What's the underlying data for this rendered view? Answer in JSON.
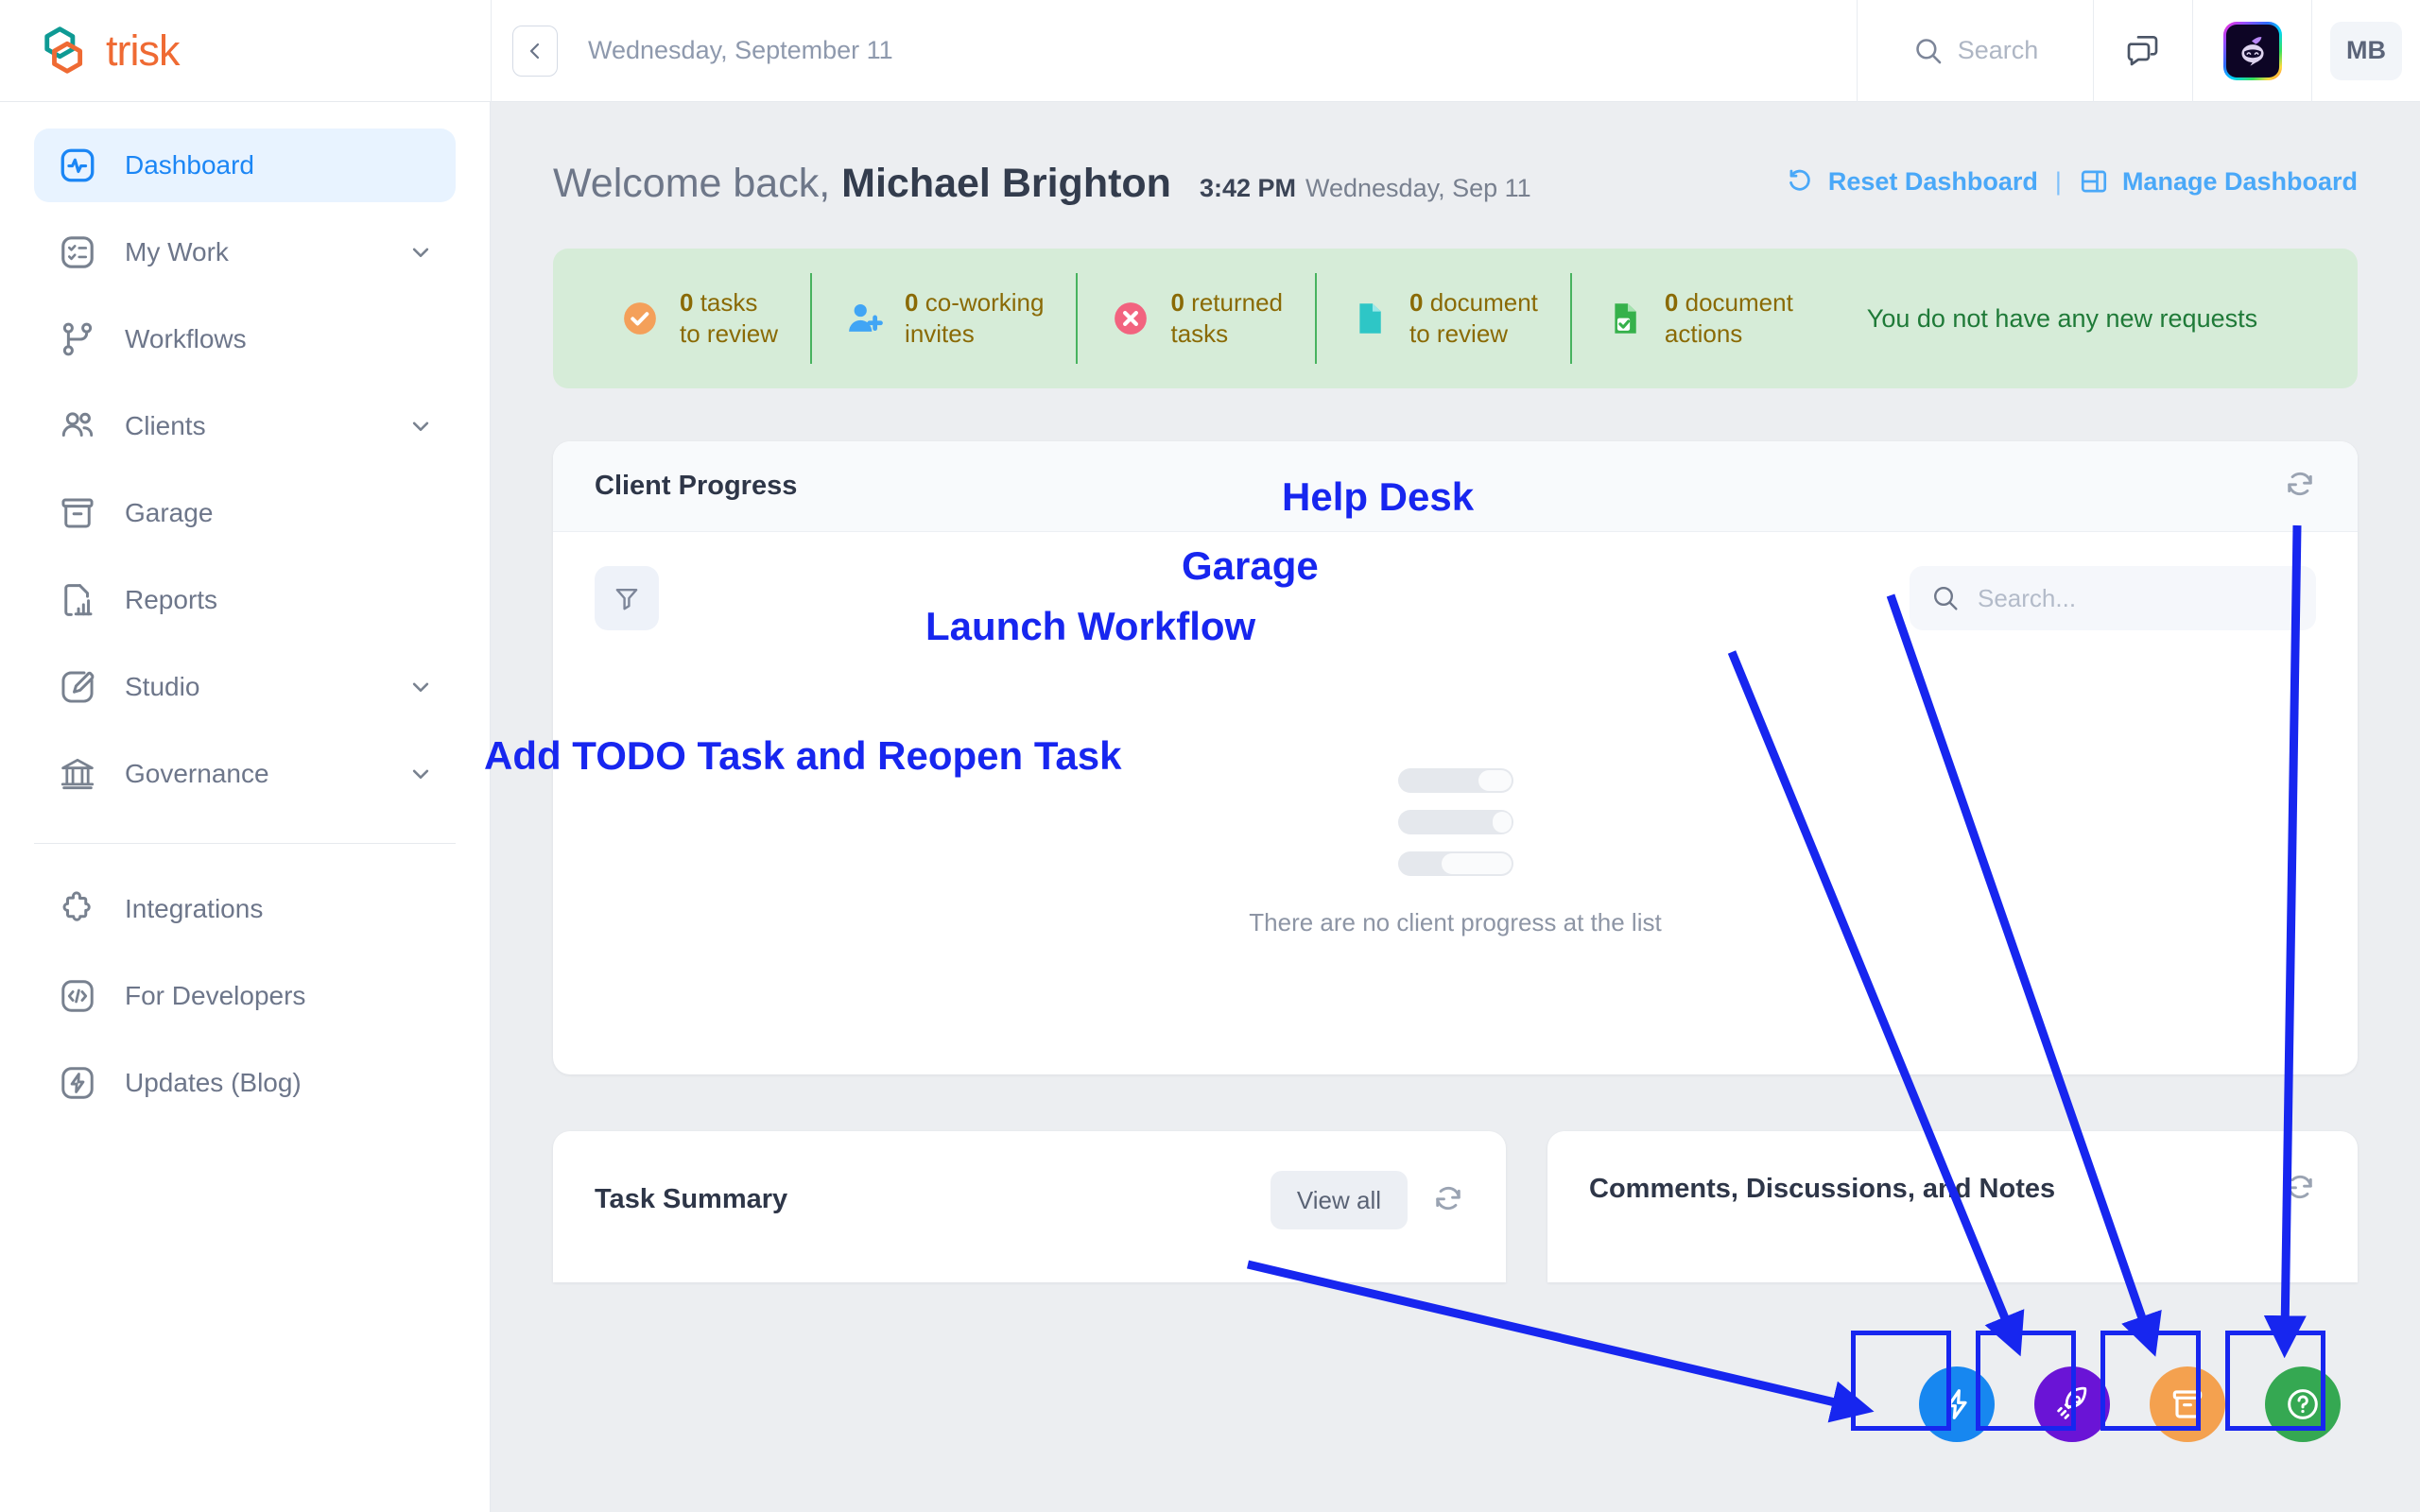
{
  "brand": {
    "name": "trisk",
    "logo_icon": "trisk-hexagon-logo",
    "teal": "#0e9a94",
    "orange": "#ef6a33"
  },
  "topbar": {
    "collapse_icon": "chevron-left-icon",
    "date": "Wednesday, September 11",
    "search_label": "Search",
    "search_icon": "search-icon",
    "chat_icon": "comments-icon",
    "ai_icon": "ai-assistant-icon",
    "avatar_initials": "MB"
  },
  "sidebar": {
    "items": [
      {
        "label": "Dashboard",
        "icon": "dashboard-activity-icon",
        "active": true,
        "expandable": false
      },
      {
        "label": "My Work",
        "icon": "checklist-icon",
        "active": false,
        "expandable": true
      },
      {
        "label": "Workflows",
        "icon": "workflow-branch-icon",
        "active": false,
        "expandable": false
      },
      {
        "label": "Clients",
        "icon": "users-icon",
        "active": false,
        "expandable": true
      },
      {
        "label": "Garage",
        "icon": "archive-box-icon",
        "active": false,
        "expandable": false
      },
      {
        "label": "Reports",
        "icon": "report-chart-icon",
        "active": false,
        "expandable": false
      },
      {
        "label": "Studio",
        "icon": "brush-icon",
        "active": false,
        "expandable": true
      },
      {
        "label": "Governance",
        "icon": "bank-columns-icon",
        "active": false,
        "expandable": true
      }
    ],
    "footer_items": [
      {
        "label": "Integrations",
        "icon": "puzzle-piece-icon"
      },
      {
        "label": "For Developers",
        "icon": "code-brackets-icon"
      },
      {
        "label": "Updates (Blog)",
        "icon": "lightning-bolt-icon"
      }
    ]
  },
  "header": {
    "welcome_prefix": "Welcome back,",
    "user_name": "Michael Brighton",
    "time": "3:42 PM",
    "date": "Wednesday, Sep 11",
    "reset_label": "Reset Dashboard",
    "reset_icon": "reset-arrow-icon",
    "divider": "|",
    "manage_label": "Manage Dashboard",
    "manage_icon": "layout-panels-icon",
    "link_color": "#4aa8f8"
  },
  "stats": {
    "background": "#d6ecd8",
    "items": [
      {
        "count": "0",
        "line1_rest": "tasks",
        "line2": "to review",
        "icon": "check-circle-icon",
        "icon_color": "#f4a05a"
      },
      {
        "count": "0",
        "line1_rest": "co-working",
        "line2": "invites",
        "icon": "user-plus-icon",
        "icon_color": "#41a5f5"
      },
      {
        "count": "0",
        "line1_rest": "returned",
        "line2": "tasks",
        "icon": "x-circle-icon",
        "icon_color": "#f2637f"
      },
      {
        "count": "0",
        "line1_rest": "document",
        "line2": "to review",
        "icon": "document-icon",
        "icon_color": "#2ec6c6"
      },
      {
        "count": "0",
        "line1_rest": "document",
        "line2": "actions",
        "icon": "document-check-icon",
        "icon_color": "#36b14b"
      }
    ],
    "note": "You do not have any new requests"
  },
  "client_progress": {
    "title": "Client Progress",
    "refresh_icon": "refresh-icon",
    "filter_icon": "filter-funnel-icon",
    "search_placeholder": "Search...",
    "search_icon": "search-icon",
    "empty_message": "There are no client progress at the list"
  },
  "bottom_cards": [
    {
      "title": "Task Summary",
      "view_all_label": "View all",
      "refresh_icon": "refresh-icon"
    },
    {
      "title": "Comments, Discussions, and Notes",
      "refresh_icon": "refresh-icon"
    }
  ],
  "fabs": [
    {
      "name": "add-todo-task",
      "icon": "lightning-bolt-icon",
      "color": "#1787f0"
    },
    {
      "name": "launch-workflow",
      "icon": "rocket-icon",
      "color": "#6a14d6"
    },
    {
      "name": "garage",
      "icon": "archive-box-icon",
      "color": "#f4a14f"
    },
    {
      "name": "help-desk",
      "icon": "question-circle-icon",
      "color": "#35a852"
    }
  ],
  "annotations": {
    "color": "#1726ef",
    "labels": [
      {
        "text": "Help Desk"
      },
      {
        "text": "Garage"
      },
      {
        "text": "Launch Workflow"
      },
      {
        "text": "Add TODO Task and Reopen Task"
      }
    ]
  }
}
